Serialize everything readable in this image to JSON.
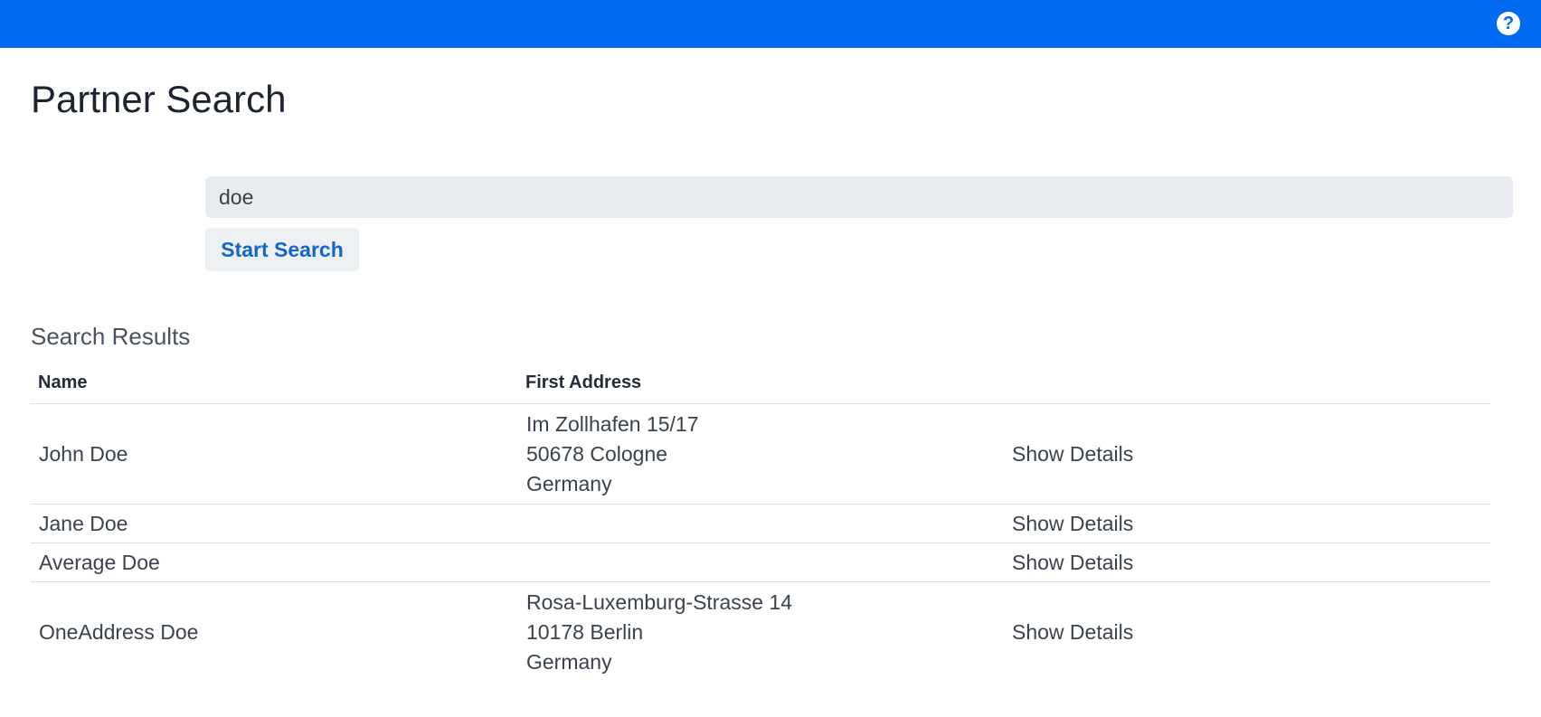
{
  "header": {
    "help_icon": "question-circle-icon",
    "accent_color": "#006bf1"
  },
  "page": {
    "title": "Partner Search"
  },
  "search": {
    "value": "doe",
    "button_label": "Start Search"
  },
  "results": {
    "title": "Search Results",
    "columns": [
      "Name",
      "First Address",
      ""
    ],
    "rows": [
      {
        "name": "John Doe",
        "address": [
          "Im Zollhafen 15/17",
          "50678 Cologne",
          "Germany"
        ],
        "action": "Show Details"
      },
      {
        "name": "Jane Doe",
        "address": [],
        "action": "Show Details"
      },
      {
        "name": "Average Doe",
        "address": [],
        "action": "Show Details"
      },
      {
        "name": "OneAddress Doe",
        "address": [
          "Rosa-Luxemburg-Strasse 14",
          "10178 Berlin",
          "Germany"
        ],
        "action": "Show Details"
      }
    ]
  }
}
